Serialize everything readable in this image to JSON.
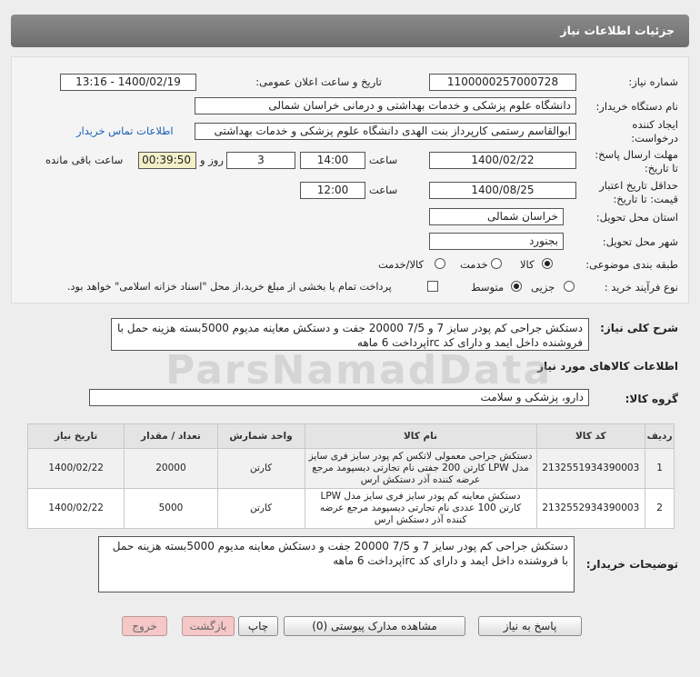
{
  "header": {
    "title": "جزئیات اطلاعات نیاز"
  },
  "fields": {
    "need_number_label": "شماره نیاز:",
    "need_number": "1100000257000728",
    "announce_label": "تاریخ و ساعت اعلان عمومی:",
    "announce_value": "1400/02/19 - 13:16",
    "buyer_label": "نام دستگاه خریدار:",
    "buyer_value": "دانشگاه علوم پزشکی و خدمات بهداشتی و درمانی خراسان شمالی",
    "creator_label_1": "ایجاد کننده",
    "creator_label_2": "درخواست:",
    "creator_value": "ابوالقاسم رستمی کارپرداز بنت الهدی دانشگاه علوم پزشکی و خدمات بهداشتی",
    "contact_link": "اطلاعات تماس خریدار",
    "deadline_label_1": "مهلت ارسال پاسخ:",
    "deadline_label_2": "تا تاریخ:",
    "deadline_date": "1400/02/22",
    "time_label": "ساعت",
    "deadline_time": "14:00",
    "days_value": "3",
    "days_label": "روز و",
    "remaining_value": "00:39:50",
    "remaining_label": "ساعت باقی مانده",
    "validity_label_1": "حداقل تاریخ اعتبار",
    "validity_label_2": "قیمت: تا تاریخ:",
    "validity_date": "1400/08/25",
    "validity_time": "12:00",
    "province_label": "استان محل تحویل:",
    "province_value": "خراسان شمالی",
    "city_label": "شهر محل تحویل:",
    "city_value": "بجنورد",
    "category_label": "طبقه بندی موضوعی:",
    "category_options": [
      "کالا",
      "خدمت",
      "کالا/خدمت"
    ],
    "purchase_label": "نوع فرآیند خرید :",
    "purchase_options": [
      "جزیی",
      "متوسط"
    ],
    "payment_note": "پرداخت تمام یا بخشی از مبلغ خرید،از محل \"اسناد خزانه اسلامی\" خواهد بود."
  },
  "description": {
    "label": "شرح کلی نیاز:",
    "text": "دستکش جراحی کم پودر سایز 7 و 7/5 20000 جفت و دستکش معاینه مدیوم 5000بسته هزینه حمل با فروشنده داخل ایمد و دارای کد ircپرداخت 6 ماهه"
  },
  "goods": {
    "section_title": "اطلاعات کالاهای مورد نیاز",
    "group_label": "گروه کالا:",
    "group_value": "دارو، پزشکی و سلامت",
    "columns": [
      "ردیف",
      "کد کالا",
      "نام کالا",
      "واحد شمارش",
      "تعداد / مقدار",
      "تاریخ نیاز"
    ],
    "rows": [
      {
        "idx": "1",
        "code": "2132551934390003",
        "name": "دستکش جراحی معمولی لاتکس کم پودر سایز فری سایز مدل LPW کارتن 200 جفتی نام تجارتی دیسپومد مرجع عرضه کننده آذر دستکش ارس",
        "unit": "کارتن",
        "qty": "20000",
        "date": "1400/02/22"
      },
      {
        "idx": "2",
        "code": "2132552934390003",
        "name": "دستکش معاینه کم پودر سایز فری سایز مدل LPW کارتن 100 عددی نام تجارتی دیسپومد مرجع عرضه کننده آذر دستکش ارس",
        "unit": "کارتن",
        "qty": "5000",
        "date": "1400/02/22"
      }
    ]
  },
  "buyer_notes": {
    "label": "توضیحات خریدار:",
    "text": "دستکش جراحی کم پودر سایز 7 و 7/5 20000 جفت و دستکش معاینه مدیوم 5000بسته هزینه حمل با فروشنده داخل ایمد و دارای کد ircپرداخت 6 ماهه"
  },
  "buttons": {
    "reply": "پاسخ به نیاز",
    "attachments": "مشاهده مدارک پیوستی (0)",
    "print": "چاپ",
    "back": "بازگشت",
    "exit": "خروج"
  }
}
